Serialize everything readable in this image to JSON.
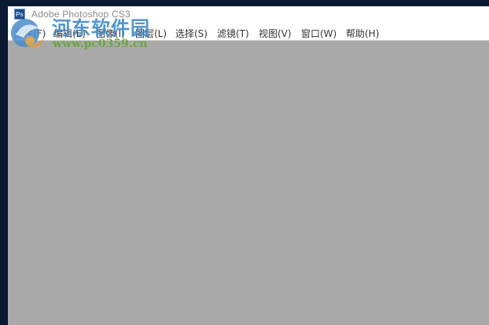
{
  "window": {
    "title": "Adobe Photoshop CS3",
    "app_icon_label": "Ps"
  },
  "menubar": {
    "items": [
      {
        "label": "文件(F)"
      },
      {
        "label": "编辑(E)"
      },
      {
        "label": "图像(I)"
      },
      {
        "label": "图层(L)"
      },
      {
        "label": "选择(S)"
      },
      {
        "label": "滤镜(T)"
      },
      {
        "label": "视图(V)"
      },
      {
        "label": "窗口(W)"
      },
      {
        "label": "帮助(H)"
      }
    ]
  },
  "watermark": {
    "site_name": "河东软件园",
    "url": "www.pc0359.cn"
  },
  "colors": {
    "workspace": "#a9a9a9",
    "desktop": "#0b1a33",
    "app_icon": "#1f4a87"
  }
}
